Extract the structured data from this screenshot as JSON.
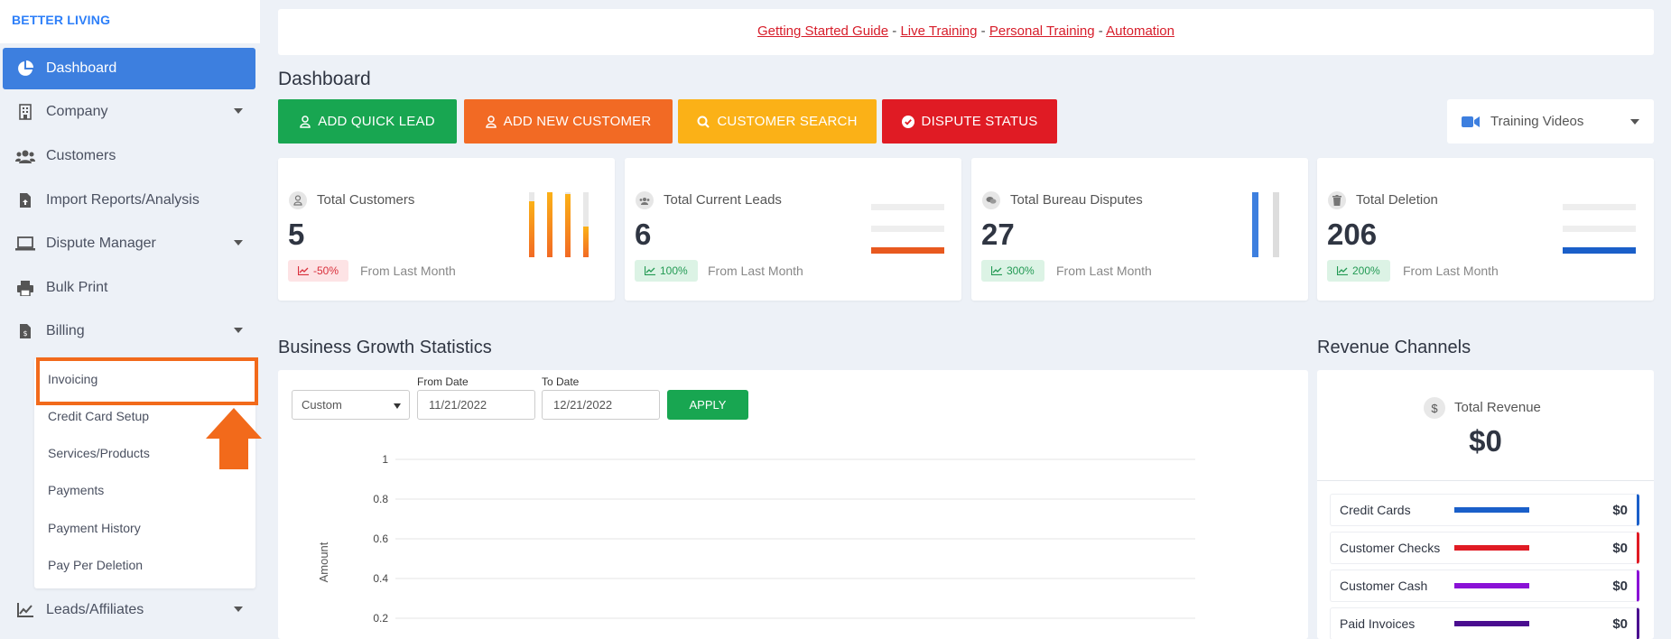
{
  "brand": "BETTER LIVING",
  "sidebar": {
    "items": [
      {
        "label": "Dashboard"
      },
      {
        "label": "Company"
      },
      {
        "label": "Customers"
      },
      {
        "label": "Import Reports/Analysis"
      },
      {
        "label": "Dispute Manager"
      },
      {
        "label": "Bulk Print"
      },
      {
        "label": "Billing"
      },
      {
        "label": "Leads/Affiliates"
      }
    ],
    "billing_submenu": [
      {
        "label": "Invoicing"
      },
      {
        "label": "Credit Card Setup"
      },
      {
        "label": "Services/Products"
      },
      {
        "label": "Payments"
      },
      {
        "label": "Payment History"
      },
      {
        "label": "Pay Per Deletion"
      }
    ]
  },
  "topbar": {
    "links": [
      "Getting Started Guide",
      "Live Training",
      "Personal Training",
      "Automation"
    ],
    "separator": "-"
  },
  "page_title": "Dashboard",
  "actions": {
    "add_quick_lead": "ADD QUICK LEAD",
    "add_new_customer": "ADD NEW CUSTOMER",
    "customer_search": "CUSTOMER SEARCH",
    "dispute_status": "DISPUTE STATUS",
    "training_videos": "Training Videos"
  },
  "stats": [
    {
      "label": "Total Customers",
      "value": "5",
      "change": "-50%",
      "from": "From Last Month"
    },
    {
      "label": "Total Current Leads",
      "value": "6",
      "change": "100%",
      "from": "From Last Month"
    },
    {
      "label": "Total Bureau Disputes",
      "value": "27",
      "change": "300%",
      "from": "From Last Month"
    },
    {
      "label": "Total Deletion",
      "value": "206",
      "change": "200%",
      "from": "From Last Month"
    }
  ],
  "growth": {
    "title": "Business Growth Statistics",
    "range_select": "Custom",
    "from_label": "From Date",
    "from_value": "11/21/2022",
    "to_label": "To Date",
    "to_value": "12/21/2022",
    "apply": "APPLY",
    "ylabel": "Amount",
    "yticks": [
      "1",
      "0.8",
      "0.6",
      "0.4",
      "0.2"
    ]
  },
  "revenue": {
    "title": "Revenue Channels",
    "total_label": "Total Revenue",
    "total_value": "$0",
    "icon_glyph": "$",
    "channels": [
      {
        "name": "Credit Cards",
        "value": "$0",
        "color": "#1a5fc9"
      },
      {
        "name": "Customer Checks",
        "value": "$0",
        "color": "#e01b24"
      },
      {
        "name": "Customer Cash",
        "value": "$0",
        "color": "#8a12d6"
      },
      {
        "name": "Paid Invoices",
        "value": "$0",
        "color": "#4a0d8f"
      }
    ]
  },
  "colors": {
    "active_nav": "#3d7fdf",
    "green": "#18a651",
    "orange": "#f26a24",
    "yellow": "#fbb117",
    "red": "#e01b24",
    "highlight": "#f26a1b"
  }
}
